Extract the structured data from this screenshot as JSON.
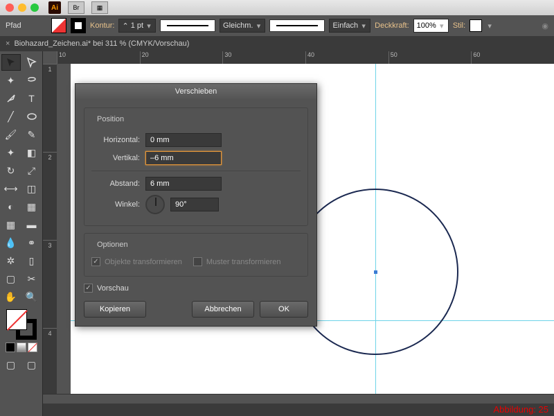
{
  "titlebar": {
    "logo": "Ai",
    "br": "Br"
  },
  "options": {
    "pfad": "Pfad",
    "kontur": "Kontur:",
    "stroke_weight": "1 pt",
    "caps": "Gleichm.",
    "corners": "Einfach",
    "opacity_label": "Deckkraft:",
    "opacity": "100%",
    "stil": "Stil:"
  },
  "tab": {
    "close": "×",
    "title": "Biohazard_Zeichen.ai* bei 311 % (CMYK/Vorschau)"
  },
  "ruler_h": [
    "10",
    "20",
    "30",
    "40",
    "50",
    "60"
  ],
  "ruler_v": [
    "1",
    "2",
    "3",
    "4"
  ],
  "dialog": {
    "title": "Verschieben",
    "position": "Position",
    "horizontal": "Horizontal:",
    "horizontal_v": "0 mm",
    "vertikal": "Vertikal:",
    "vertikal_v": "–6 mm",
    "abstand": "Abstand:",
    "abstand_v": "6 mm",
    "winkel": "Winkel:",
    "winkel_v": "90°",
    "optionen": "Optionen",
    "obj_trans": "Objekte transformieren",
    "muster_trans": "Muster transformieren",
    "vorschau": "Vorschau",
    "kopieren": "Kopieren",
    "abbrechen": "Abbrechen",
    "ok": "OK"
  },
  "figure": "Abbildung: 25"
}
